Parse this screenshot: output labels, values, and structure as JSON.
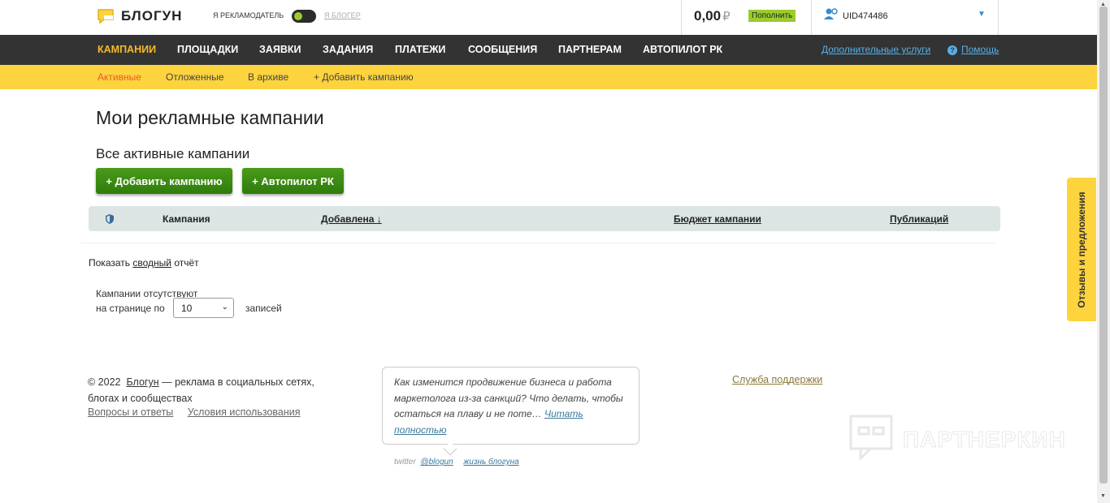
{
  "header": {
    "logo_text": "БЛОГУН",
    "role_advertiser": "Я РЕКЛАМОДАТЕЛЬ",
    "role_blogger": "Я БЛОГЕР",
    "balance": "0,00",
    "currency": "₽",
    "topup_label": "Пополнить",
    "user_id": "UID474486"
  },
  "nav": {
    "items": [
      "КАМПАНИИ",
      "ПЛОЩАДКИ",
      "ЗАЯВКИ",
      "ЗАДАНИЯ",
      "ПЛАТЕЖИ",
      "СООБЩЕНИЯ",
      "ПАРТНЕРАМ",
      "АВТОПИЛОТ РК"
    ],
    "extra_services": "Дополнительные услуги",
    "help": "Помощь"
  },
  "subnav": {
    "items": [
      "Активные",
      "Отложенные",
      "В архиве",
      "+ Добавить кампанию"
    ]
  },
  "main": {
    "title": "Мои рекламные кампании",
    "subtitle": "Все активные кампании",
    "add_campaign_button": "+ Добавить кампанию",
    "autopilot_button": "+ Автопилот РК",
    "table": {
      "columns": [
        "Кампания",
        "Добавлена ↓",
        "Бюджет кампании",
        "Публикаций"
      ]
    },
    "summary_prefix": "Показать",
    "summary_link": "сводный",
    "summary_suffix": "отчёт",
    "empty_text": "Кампании отсутствуют",
    "per_page_label": "на странице по",
    "per_page_value": "10",
    "records_label": "записей"
  },
  "footer": {
    "copyright": "© 2022",
    "brand_link": "Блогун",
    "tagline": "— реклама в социальных сетях, блогах и сообществах",
    "faq": "Вопросы и ответы",
    "terms": "Условия использования",
    "news_text": "Как изменится продвижение бизнеса и работа маркетолога из-за санкций? Что делать, чтобы остаться на плаву и не поте…",
    "news_link": "Читать полностью",
    "twitter_label": "twitter",
    "twitter_handle": "@blogun",
    "blog_link": "жизнь блогуна",
    "support": "Служба поддержки"
  },
  "feedback_tab": "Отзывы и предложения",
  "watermark": "ПАРТНЕРКИН",
  "colors": {
    "nav_bg": "#333333",
    "subnav_bg": "#fdd33e",
    "accent_green": "#2e7d0c",
    "active_orange": "#e55a2b"
  }
}
